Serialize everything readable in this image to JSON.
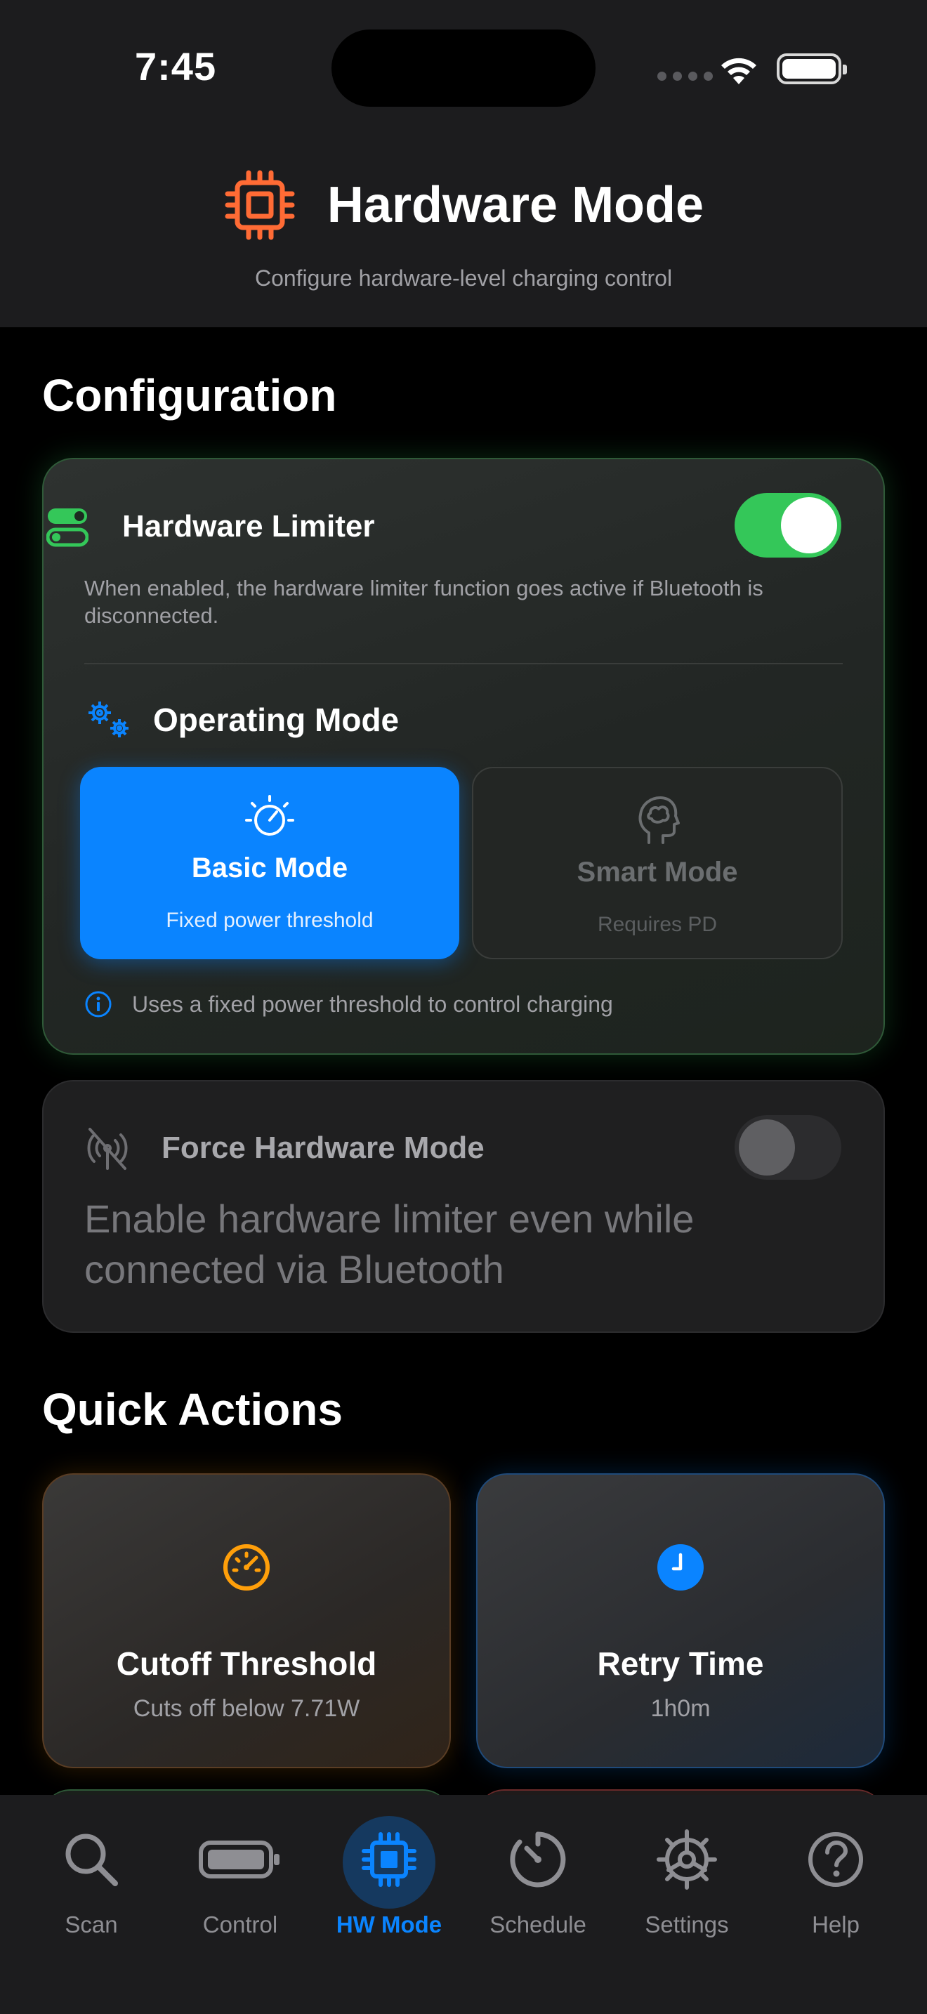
{
  "status_bar": {
    "time": "7:45"
  },
  "header": {
    "title": "Hardware Mode",
    "subtitle": "Configure hardware-level charging control",
    "icon": "cpu-chip-icon",
    "accent": "#ff6b35"
  },
  "configuration": {
    "section_title": "Configuration",
    "hardware_limiter": {
      "label": "Hardware Limiter",
      "enabled": true,
      "description": "When enabled, the hardware limiter function goes active if Bluetooth is disconnected."
    },
    "operating_mode": {
      "label": "Operating Mode",
      "options": [
        {
          "name": "Basic Mode",
          "subtitle": "Fixed power threshold",
          "selected": true,
          "icon": "gauge-dial-icon"
        },
        {
          "name": "Smart Mode",
          "subtitle": "Requires PD",
          "selected": false,
          "disabled": true,
          "icon": "brain-head-icon"
        }
      ],
      "info": "Uses a fixed power threshold to control charging"
    }
  },
  "force_hardware_mode": {
    "label": "Force Hardware Mode",
    "enabled": false,
    "description": "Enable hardware limiter even while connected via Bluetooth"
  },
  "quick_actions": {
    "section_title": "Quick Actions",
    "items": [
      {
        "name": "Cutoff Threshold",
        "value": "Cuts off below 7.71W",
        "icon": "speedometer-icon",
        "color": "#ff9f0a"
      },
      {
        "name": "Retry Time",
        "value": "1h0m",
        "icon": "clock-icon",
        "color": "#0a84ff"
      }
    ]
  },
  "tab_bar": {
    "active": "HW Mode",
    "tabs": [
      {
        "label": "Scan",
        "icon": "magnifier-icon"
      },
      {
        "label": "Control",
        "icon": "battery-icon"
      },
      {
        "label": "HW Mode",
        "icon": "cpu-chip-icon"
      },
      {
        "label": "Schedule",
        "icon": "timer-icon"
      },
      {
        "label": "Settings",
        "icon": "gear-icon"
      },
      {
        "label": "Help",
        "icon": "question-icon"
      }
    ]
  },
  "colors": {
    "accent_blue": "#0a84ff",
    "toggle_green": "#34c759",
    "background": "#000000",
    "surface": "#1c1c1e"
  }
}
